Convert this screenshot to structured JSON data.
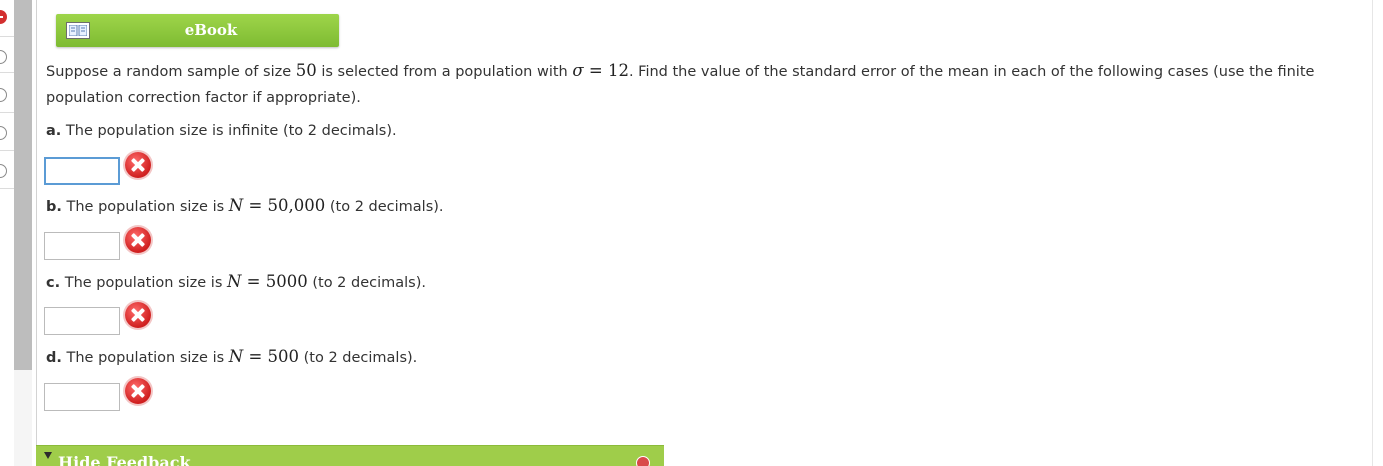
{
  "ebook": {
    "label": "eBook",
    "icon": "book-icon"
  },
  "question": {
    "intro_1": "Suppose a random sample of size ",
    "n": "50",
    "intro_2": " is selected from a population with ",
    "sigma_sym": "σ",
    "eq": " = ",
    "sigma_val": "12",
    "intro_3": ". Find the value of the standard error of the mean in each of the following cases (use the finite population correction factor if appropriate).",
    "parts": [
      {
        "letter": "a.",
        "text": " The population size is infinite (to 2 decimals)."
      },
      {
        "letter": "b.",
        "pre": " The population size is ",
        "var": "N",
        "eq": " = ",
        "value": "50,000",
        "post": " (to 2 decimals)."
      },
      {
        "letter": "c.",
        "pre": " The population size is ",
        "var": "N",
        "eq": " = ",
        "value": "5000",
        "post": " (to 2 decimals)."
      },
      {
        "letter": "d.",
        "pre": " The population size is ",
        "var": "N",
        "eq": " = ",
        "value": "500",
        "post": " (to 2 decimals)."
      }
    ],
    "answers": [
      "",
      "",
      "",
      ""
    ]
  },
  "feedback": {
    "label": "Hide Feedback"
  },
  "colors": {
    "accent_green": "#8bc34a",
    "error_red": "#d32f2f",
    "focus_blue": "#5b9bd5"
  }
}
